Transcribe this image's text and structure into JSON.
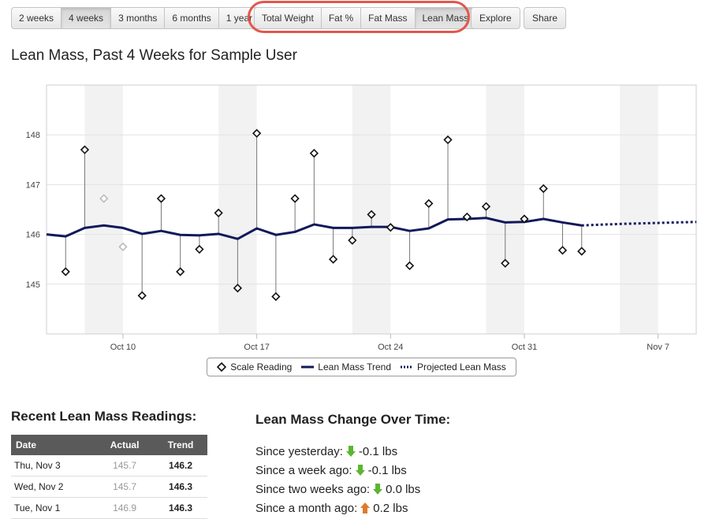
{
  "ranges": {
    "items": [
      "2 weeks",
      "4 weeks",
      "3 months",
      "6 months",
      "1 year"
    ],
    "active": 1
  },
  "metrics": {
    "items": [
      "Total Weight",
      "Fat %",
      "Fat Mass",
      "Lean Mass"
    ],
    "active": 3
  },
  "explore_label": "Explore",
  "share_label": "Share",
  "page_title": "Lean Mass, Past 4 Weeks for Sample User",
  "chart_data": {
    "type": "line",
    "title": "Lean Mass, Past 4 Weeks for Sample User",
    "y_ticks": [
      "145",
      "146",
      "147",
      "148"
    ],
    "ylim": [
      144.0,
      149.0
    ],
    "x_ticks": [
      "Oct 10",
      "Oct 17",
      "Oct 24",
      "Oct 31",
      "Nov 7"
    ],
    "x_start": "Oct 6",
    "x_end": "Nov 8",
    "grid": true,
    "legend": "bottom-center",
    "series": [
      {
        "name": "Scale Reading",
        "x": [
          7,
          8,
          9,
          10,
          11,
          12,
          13,
          14,
          15,
          16,
          17,
          18,
          19,
          20,
          21,
          22,
          23,
          24,
          25,
          26,
          27,
          28,
          29,
          30,
          31,
          32,
          33,
          34
        ],
        "values": [
          145.25,
          147.7,
          146.72,
          145.75,
          144.77,
          146.72,
          145.25,
          145.7,
          146.43,
          144.92,
          148.03,
          144.75,
          146.72,
          147.63,
          145.5,
          145.88,
          146.4,
          146.14,
          145.37,
          146.62,
          147.9,
          146.35,
          146.56,
          145.42,
          146.31,
          146.92,
          145.68,
          145.66
        ]
      },
      {
        "name": "Lean Mass Trend",
        "x": [
          6,
          7,
          8,
          9,
          10,
          11,
          12,
          13,
          14,
          15,
          16,
          17,
          18,
          19,
          20,
          21,
          22,
          23,
          24,
          25,
          26,
          27,
          28,
          29,
          30,
          31,
          32,
          33,
          34
        ],
        "values": [
          146.0,
          145.96,
          146.13,
          146.18,
          146.13,
          146.01,
          146.07,
          145.99,
          145.98,
          146.01,
          145.91,
          146.12,
          145.99,
          146.05,
          146.2,
          146.13,
          146.13,
          146.15,
          146.15,
          146.07,
          146.12,
          146.3,
          146.31,
          146.33,
          146.24,
          146.25,
          146.31,
          146.24,
          146.18
        ]
      },
      {
        "name": "Projected Lean Mass",
        "x": [
          34,
          36,
          38,
          40
        ],
        "values": [
          146.18,
          146.21,
          146.23,
          146.25
        ]
      }
    ],
    "faded_readings": [
      2,
      3
    ],
    "colors": {
      "trend": "#12195a",
      "projected": "#12195a",
      "marker": "#111111",
      "faded": "#bbbbbb",
      "band": "#f2f2f2"
    }
  },
  "legend": {
    "scale": "Scale Reading",
    "trend": "Lean Mass Trend",
    "projected": "Projected Lean Mass"
  },
  "recent": {
    "title": "Recent Lean Mass Readings:",
    "headers": [
      "Date",
      "Actual",
      "Trend"
    ],
    "rows": [
      [
        "Thu, Nov 3",
        "145.7",
        "146.2"
      ],
      [
        "Wed, Nov 2",
        "145.7",
        "146.3"
      ],
      [
        "Tue, Nov 1",
        "146.9",
        "146.3"
      ]
    ]
  },
  "change": {
    "title": "Lean Mass Change Over Time:",
    "rows": [
      {
        "label": "Since yesterday:",
        "dir": "down",
        "value": "-0.1 lbs"
      },
      {
        "label": "Since a week ago:",
        "dir": "down",
        "value": "-0.1 lbs"
      },
      {
        "label": "Since two weeks ago:",
        "dir": "down",
        "value": "0.0 lbs"
      },
      {
        "label": "Since a month ago:",
        "dir": "up",
        "value": "0.2 lbs"
      }
    ]
  }
}
